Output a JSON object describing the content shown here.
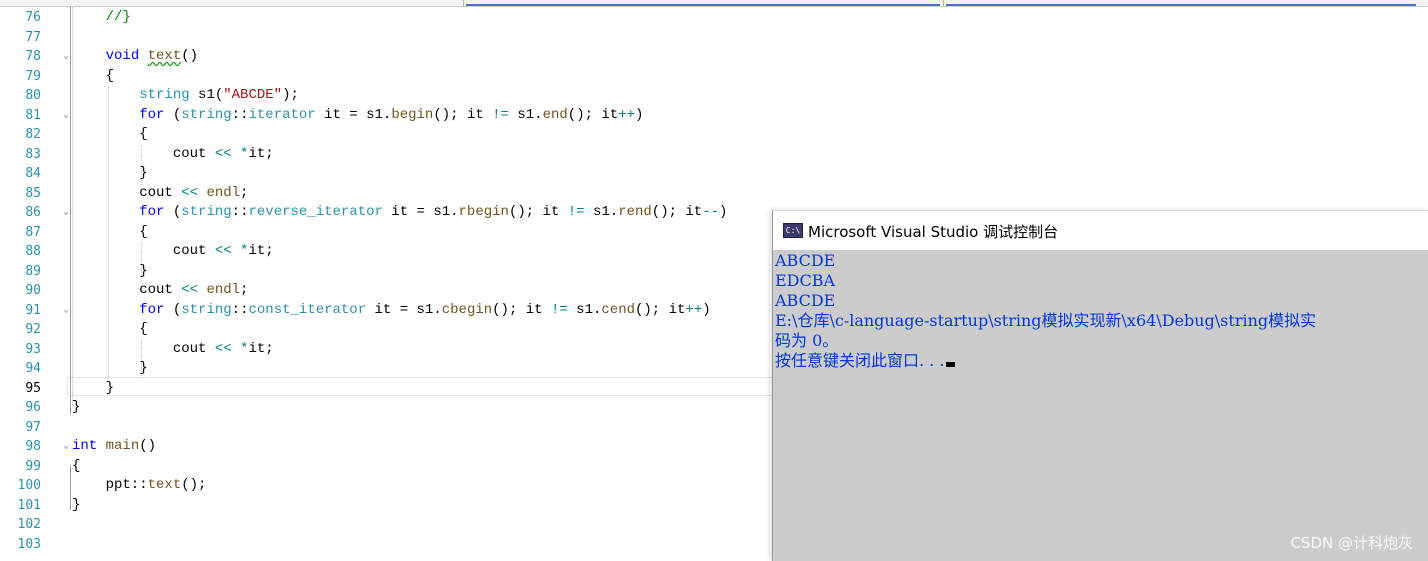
{
  "editor": {
    "current_line": "95",
    "lines": [
      {
        "num": "76",
        "segments": [
          {
            "t": "    "
          },
          {
            "t": "//}",
            "c": "cm"
          }
        ]
      },
      {
        "num": "77",
        "segments": []
      },
      {
        "num": "78",
        "segments": [
          {
            "t": "    "
          },
          {
            "t": "void",
            "c": "kw"
          },
          {
            "t": " "
          },
          {
            "t": "text",
            "c": "fn squiggle"
          },
          {
            "t": "()"
          }
        ]
      },
      {
        "num": "79",
        "segments": [
          {
            "t": "    {"
          }
        ]
      },
      {
        "num": "80",
        "segments": [
          {
            "t": "        "
          },
          {
            "t": "string",
            "c": "ty"
          },
          {
            "t": " s1("
          },
          {
            "t": "\"ABCDE\"",
            "c": "st"
          },
          {
            "t": ");"
          }
        ]
      },
      {
        "num": "81",
        "segments": [
          {
            "t": "        "
          },
          {
            "t": "for",
            "c": "kw"
          },
          {
            "t": " ("
          },
          {
            "t": "string",
            "c": "ty"
          },
          {
            "t": "::"
          },
          {
            "t": "iterator",
            "c": "ty"
          },
          {
            "t": " it = s1."
          },
          {
            "t": "begin",
            "c": "fn"
          },
          {
            "t": "(); it "
          },
          {
            "t": "!=",
            "c": "op"
          },
          {
            "t": " s1."
          },
          {
            "t": "end",
            "c": "fn"
          },
          {
            "t": "(); it"
          },
          {
            "t": "++",
            "c": "op"
          },
          {
            "t": ")"
          }
        ]
      },
      {
        "num": "82",
        "segments": [
          {
            "t": "        {"
          }
        ]
      },
      {
        "num": "83",
        "segments": [
          {
            "t": "            cout "
          },
          {
            "t": "<<",
            "c": "op"
          },
          {
            "t": " "
          },
          {
            "t": "*",
            "c": "op"
          },
          {
            "t": "it;"
          }
        ]
      },
      {
        "num": "84",
        "segments": [
          {
            "t": "        }"
          }
        ]
      },
      {
        "num": "85",
        "segments": [
          {
            "t": "        cout "
          },
          {
            "t": "<<",
            "c": "op"
          },
          {
            "t": " "
          },
          {
            "t": "endl",
            "c": "fn"
          },
          {
            "t": ";"
          }
        ]
      },
      {
        "num": "86",
        "segments": [
          {
            "t": "        "
          },
          {
            "t": "for",
            "c": "kw"
          },
          {
            "t": " ("
          },
          {
            "t": "string",
            "c": "ty"
          },
          {
            "t": "::"
          },
          {
            "t": "reverse_iterator",
            "c": "ty"
          },
          {
            "t": " it = s1."
          },
          {
            "t": "rbegin",
            "c": "fn"
          },
          {
            "t": "(); it "
          },
          {
            "t": "!=",
            "c": "op"
          },
          {
            "t": " s1."
          },
          {
            "t": "rend",
            "c": "fn"
          },
          {
            "t": "(); it"
          },
          {
            "t": "--",
            "c": "op"
          },
          {
            "t": ")"
          }
        ]
      },
      {
        "num": "87",
        "segments": [
          {
            "t": "        {"
          }
        ]
      },
      {
        "num": "88",
        "segments": [
          {
            "t": "            cout "
          },
          {
            "t": "<<",
            "c": "op"
          },
          {
            "t": " "
          },
          {
            "t": "*",
            "c": "op"
          },
          {
            "t": "it;"
          }
        ]
      },
      {
        "num": "89",
        "segments": [
          {
            "t": "        }"
          }
        ]
      },
      {
        "num": "90",
        "segments": [
          {
            "t": "        cout "
          },
          {
            "t": "<<",
            "c": "op"
          },
          {
            "t": " "
          },
          {
            "t": "endl",
            "c": "fn"
          },
          {
            "t": ";"
          }
        ]
      },
      {
        "num": "91",
        "segments": [
          {
            "t": "        "
          },
          {
            "t": "for",
            "c": "kw"
          },
          {
            "t": " ("
          },
          {
            "t": "string",
            "c": "ty"
          },
          {
            "t": "::"
          },
          {
            "t": "const_iterator",
            "c": "ty"
          },
          {
            "t": " it = s1."
          },
          {
            "t": "cbegin",
            "c": "fn"
          },
          {
            "t": "(); it "
          },
          {
            "t": "!=",
            "c": "op"
          },
          {
            "t": " s1."
          },
          {
            "t": "cend",
            "c": "fn"
          },
          {
            "t": "(); it"
          },
          {
            "t": "++",
            "c": "op"
          },
          {
            "t": ")"
          }
        ]
      },
      {
        "num": "92",
        "segments": [
          {
            "t": "        {"
          }
        ]
      },
      {
        "num": "93",
        "segments": [
          {
            "t": "            cout "
          },
          {
            "t": "<<",
            "c": "op"
          },
          {
            "t": " "
          },
          {
            "t": "*",
            "c": "op"
          },
          {
            "t": "it;"
          }
        ]
      },
      {
        "num": "94",
        "segments": [
          {
            "t": "        }"
          }
        ]
      },
      {
        "num": "95",
        "segments": [
          {
            "t": "    }"
          }
        ]
      },
      {
        "num": "96",
        "segments": [
          {
            "t": "}"
          }
        ]
      },
      {
        "num": "97",
        "segments": []
      },
      {
        "num": "98",
        "segments": [
          {
            "t": "int",
            "c": "kw"
          },
          {
            "t": " "
          },
          {
            "t": "main",
            "c": "fn"
          },
          {
            "t": "()"
          }
        ]
      },
      {
        "num": "99",
        "segments": [
          {
            "t": "{"
          }
        ]
      },
      {
        "num": "100",
        "segments": [
          {
            "t": "    ppt::"
          },
          {
            "t": "text",
            "c": "fn"
          },
          {
            "t": "();"
          }
        ]
      },
      {
        "num": "101",
        "segments": [
          {
            "t": "}"
          }
        ]
      },
      {
        "num": "102",
        "segments": []
      },
      {
        "num": "103",
        "segments": []
      }
    ]
  },
  "console": {
    "title": "Microsoft Visual Studio 调试控制台",
    "icon": "console-app-icon",
    "output": [
      "ABCDE",
      "EDCBA",
      "ABCDE",
      "E:\\仓库\\c-language-startup\\string模拟实现新\\x64\\Debug\\string模拟实",
      "码为 0。",
      "按任意键关闭此窗口. . ."
    ]
  },
  "watermark": "CSDN @计科炮灰"
}
